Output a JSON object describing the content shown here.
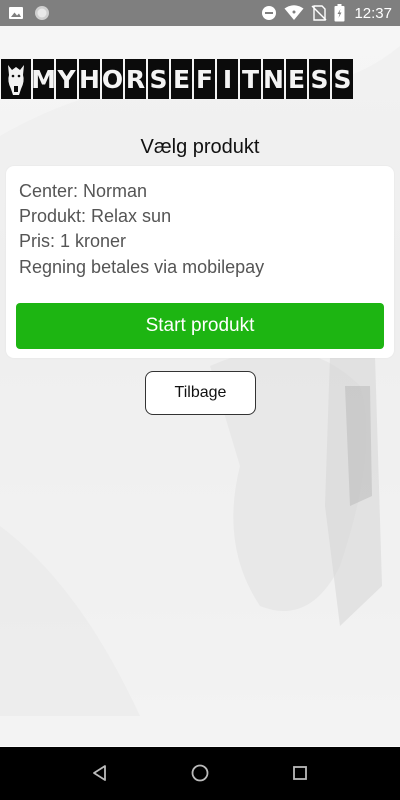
{
  "status_bar": {
    "time": "12:37",
    "icons_left": [
      "image-icon",
      "circle-icon"
    ],
    "icons_right": [
      "dnd-icon",
      "wifi-icon",
      "no-sim-icon",
      "battery-icon"
    ]
  },
  "logo": {
    "text": "MYHORSEFITNESS",
    "letters": [
      "M",
      "Y",
      "H",
      "O",
      "R",
      "S",
      "E",
      "F",
      "I",
      "T",
      "N",
      "E",
      "S",
      "S"
    ]
  },
  "page": {
    "title": "Vælg produkt"
  },
  "card": {
    "center": "Center: Norman",
    "product": "Produkt: Relax sun",
    "price": "Pris: 1 kroner",
    "payment": "Regning betales via mobilepay",
    "start_label": "Start produkt"
  },
  "back_label": "Tilbage",
  "colors": {
    "status_bar": "#7f7f7f",
    "primary_button": "#1db512",
    "nav_bar": "#000000"
  },
  "nav": [
    "back-icon",
    "home-icon",
    "recents-icon"
  ]
}
